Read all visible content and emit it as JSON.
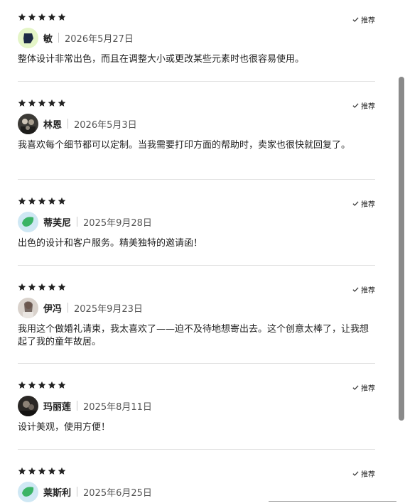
{
  "recommend_label": "推荐",
  "rating_icon": "star-icon",
  "colors": {
    "star": "#222222",
    "divider": "#e1e1e1",
    "scrollbar": "#8a8a8a",
    "check": "#333333"
  },
  "reviews": [
    {
      "stars": 5,
      "name": "敏",
      "date": "2026年5月27日",
      "avatar": "dark-pentagon-on-lime",
      "text": "整体设计非常出色，而且在调整大小或更改某些元素时也很容易使用。"
    },
    {
      "stars": 5,
      "name": "林恩",
      "date": "2026年5月3日",
      "avatar": "group-photo",
      "text": "我喜欢每个细节都可以定制。当我需要打印方面的帮助时，卖家也很快就回复了。"
    },
    {
      "stars": 5,
      "name": "蒂芙尼",
      "date": "2025年9月28日",
      "avatar": "green-leaf-on-blue",
      "text": "出色的设计和客户服务。精美独特的邀请函！"
    },
    {
      "stars": 5,
      "name": "伊冯",
      "date": "2025年9月23日",
      "avatar": "portrait-photo",
      "text": "我用这个做婚礼请柬，我太喜欢了——迫不及待地想寄出去。这个创意太棒了，让我想起了我的童年故居。"
    },
    {
      "stars": 5,
      "name": "玛丽莲",
      "date": "2025年8月11日",
      "avatar": "dark-photo",
      "text": "设计美观，使用方便！"
    },
    {
      "stars": 5,
      "name": "莱斯利",
      "date": "2025年6月25日",
      "avatar": "green-leaf-on-blue",
      "text": ""
    }
  ]
}
